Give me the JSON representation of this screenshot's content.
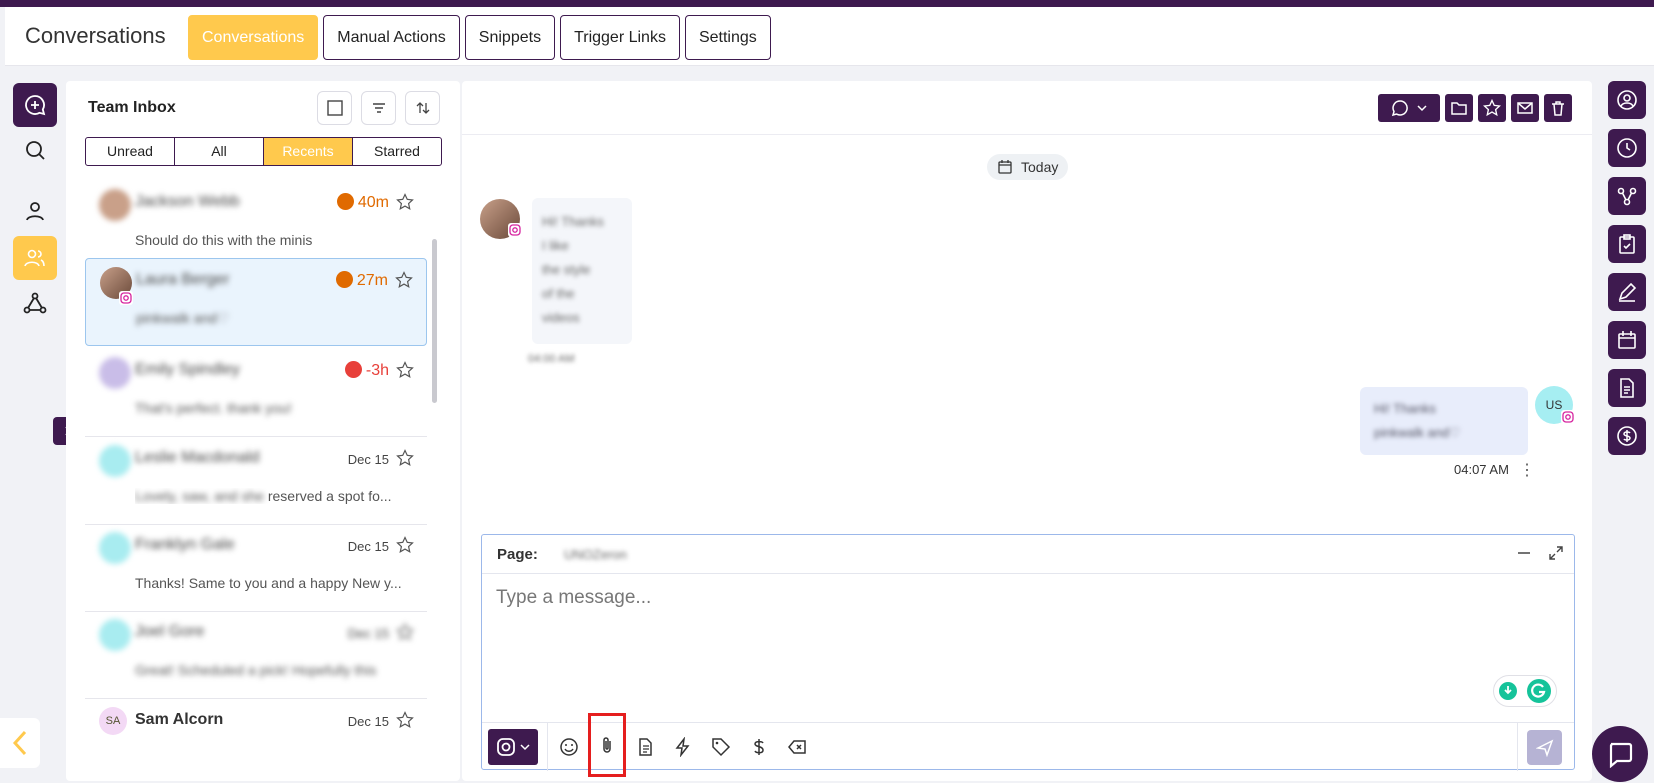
{
  "app": {
    "title": "Conversations"
  },
  "nav_tabs": [
    {
      "label": "Conversations",
      "active": true
    },
    {
      "label": "Manual Actions",
      "active": false
    },
    {
      "label": "Snippets",
      "active": false
    },
    {
      "label": "Trigger Links",
      "active": false
    },
    {
      "label": "Settings",
      "active": false
    }
  ],
  "left_nav": [
    "new-conversation-icon",
    "search-icon",
    "user-icon",
    "team-icon",
    "workflow-icon"
  ],
  "inbox": {
    "title": "Team Inbox",
    "filters": [
      {
        "label": "Unread",
        "active": false
      },
      {
        "label": "All",
        "active": false
      },
      {
        "label": "Recents",
        "active": true
      },
      {
        "label": "Starred",
        "active": false
      }
    ],
    "conversations": [
      {
        "name": "Jackson Webb",
        "preview": "Should do this with the minis",
        "time": "40m",
        "timer_color": "#e06a00",
        "selected": false,
        "blurred_preview": false
      },
      {
        "name": "Laura Berger",
        "preview": "pinkwalk and♡",
        "time": "27m",
        "timer_color": "#e06a00",
        "selected": true,
        "blurred_preview": true
      },
      {
        "name": "Emily Spindley",
        "preview": "That's perfect. thank you!",
        "time": "-3h",
        "timer_color": "#e8403a",
        "selected": false,
        "blurred_preview": true
      },
      {
        "name": "Leslie Macdonald",
        "preview_blur": "Lovely, saw, and she",
        "preview": "reserved a spot fo...",
        "date": "Dec 15",
        "selected": false
      },
      {
        "name": "Franklyn Gale",
        "preview": "Thanks! Same to you and a happy New y...",
        "date": "Dec 15",
        "selected": false,
        "blurred_preview": false
      },
      {
        "name": "Joel Gore",
        "preview": "Great! Scheduled a pick! Hopefully this",
        "date": "Dec 15",
        "selected": false,
        "blurred_preview": true
      },
      {
        "name": "Sam Alcorn",
        "preview": "",
        "date": "Dec 15",
        "initials": "SA",
        "selected": false
      }
    ]
  },
  "chat": {
    "date_divider": "Today",
    "incoming": {
      "lines": [
        "Hi! Thanks",
        "I like",
        "the style",
        "of the",
        "videos"
      ],
      "time": "04:00 AM"
    },
    "outgoing": {
      "lines": [
        "Hi! Thanks",
        "pinkwalk and♡"
      ],
      "time": "04:07 AM",
      "avatar_initials": "US"
    },
    "composer": {
      "page_label": "Page:",
      "page_value": "UNOZeron",
      "placeholder": "Type a message..."
    },
    "toolbar_icons": [
      "emoji-icon",
      "attachment-icon",
      "document-icon",
      "lightning-icon",
      "tag-icon",
      "dollar-icon",
      "clear-icon"
    ],
    "highlighted_icon": "attachment-icon"
  },
  "colors": {
    "brand": "#3e1a4f",
    "accent": "#ffc94d",
    "highlight": "#e51e1e"
  }
}
